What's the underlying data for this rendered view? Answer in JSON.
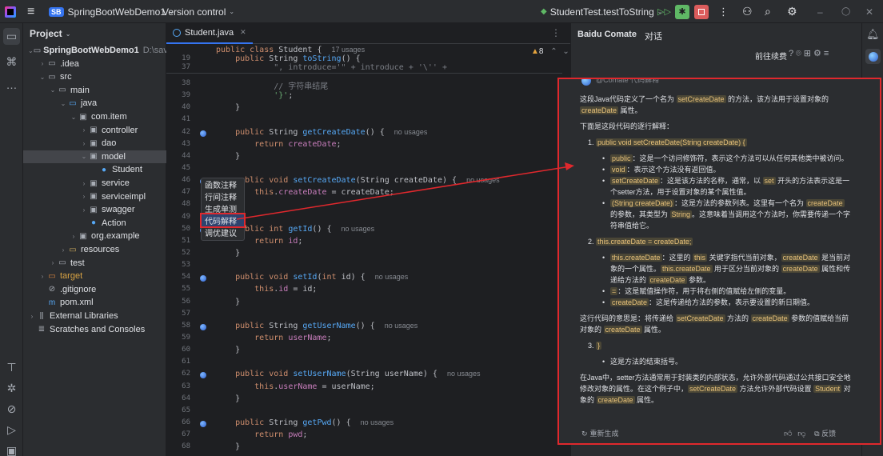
{
  "title_bar": {
    "project_badge": "SB",
    "project_name": "SpringBootWebDemo1",
    "vcs": "Version control",
    "run_config": "StudentTest.testToString"
  },
  "project_panel": {
    "title": "Project",
    "tree": [
      {
        "label": "SpringBootWebDemo1",
        "suffix": "D:\\save\\",
        "depth": 0,
        "open": true,
        "icon": "folder-icon",
        "bold": true
      },
      {
        "label": ".idea",
        "depth": 1,
        "open": false,
        "icon": "folder-icon"
      },
      {
        "label": "src",
        "depth": 1,
        "open": true,
        "icon": "folder-icon"
      },
      {
        "label": "main",
        "depth": 2,
        "open": true,
        "icon": "folder-icon"
      },
      {
        "label": "java",
        "depth": 3,
        "open": true,
        "icon": "source-folder-icon"
      },
      {
        "label": "com.item",
        "depth": 4,
        "open": true,
        "icon": "package-icon"
      },
      {
        "label": "controller",
        "depth": 5,
        "open": false,
        "icon": "package-icon"
      },
      {
        "label": "dao",
        "depth": 5,
        "open": false,
        "icon": "package-icon"
      },
      {
        "label": "model",
        "depth": 5,
        "open": true,
        "icon": "package-icon",
        "selected": true
      },
      {
        "label": "Student",
        "depth": 6,
        "icon": "class-icon"
      },
      {
        "label": "service",
        "depth": 5,
        "open": false,
        "icon": "package-icon"
      },
      {
        "label": "serviceimpl",
        "depth": 5,
        "open": false,
        "icon": "package-icon"
      },
      {
        "label": "swagger",
        "depth": 5,
        "open": false,
        "icon": "package-icon"
      },
      {
        "label": "Action",
        "depth": 5,
        "icon": "class-icon"
      },
      {
        "label": "org.example",
        "depth": 4,
        "open": false,
        "icon": "package-icon"
      },
      {
        "label": "resources",
        "depth": 3,
        "open": false,
        "icon": "resources-folder-icon"
      },
      {
        "label": "test",
        "depth": 2,
        "open": false,
        "icon": "folder-icon"
      },
      {
        "label": "target",
        "depth": 1,
        "open": false,
        "icon": "excluded-folder-icon"
      },
      {
        "label": ".gitignore",
        "depth": 1,
        "icon": "gitignore-icon"
      },
      {
        "label": "pom.xml",
        "depth": 1,
        "icon": "maven-icon"
      },
      {
        "label": "External Libraries",
        "depth": 0,
        "open": false,
        "icon": "library-icon"
      },
      {
        "label": "Scratches and Consoles",
        "depth": 0,
        "icon": "scratches-icon"
      }
    ]
  },
  "editor": {
    "tab": "Student.java",
    "warnings": "8",
    "sticky_lines": [
      {
        "num": "",
        "segs": [
          {
            "t": "public class ",
            "c": "kw"
          },
          {
            "t": "Student",
            "c": ""
          },
          {
            "t": " {  ",
            "c": ""
          },
          {
            "t": "17 usages",
            "c": "usage"
          }
        ]
      },
      {
        "num": "19",
        "segs": [
          {
            "t": "    public ",
            "c": "kw"
          },
          {
            "t": "String ",
            "c": ""
          },
          {
            "t": "toString",
            "c": "fn"
          },
          {
            "t": "() {",
            "c": ""
          }
        ]
      },
      {
        "num": "37",
        "segs": [
          {
            "t": "            \", introduce='\" + introduce + '\\'' +",
            "c": "cm"
          }
        ]
      }
    ],
    "lines": [
      {
        "num": "38",
        "segs": [
          {
            "t": "            // 字符串结尾",
            "c": "cm"
          }
        ]
      },
      {
        "num": "39",
        "segs": [
          {
            "t": "            ",
            "c": ""
          },
          {
            "t": "'}'",
            "c": "str"
          },
          {
            "t": ";",
            "c": ""
          }
        ]
      },
      {
        "num": "40",
        "segs": [
          {
            "t": "    }",
            "c": ""
          }
        ]
      },
      {
        "num": "41",
        "segs": []
      },
      {
        "num": "42",
        "icon": true,
        "segs": [
          {
            "t": "    public ",
            "c": "kw"
          },
          {
            "t": "String ",
            "c": ""
          },
          {
            "t": "getCreateDate",
            "c": "fn"
          },
          {
            "t": "() {  ",
            "c": ""
          },
          {
            "t": "no usages",
            "c": "usage"
          }
        ]
      },
      {
        "num": "43",
        "segs": [
          {
            "t": "        return ",
            "c": "kw"
          },
          {
            "t": "createDate",
            "c": "fld"
          },
          {
            "t": ";",
            "c": ""
          }
        ]
      },
      {
        "num": "44",
        "segs": [
          {
            "t": "    }",
            "c": ""
          }
        ]
      },
      {
        "num": "45",
        "segs": []
      },
      {
        "num": "46",
        "icon": true,
        "segs": [
          {
            "t": "    public void ",
            "c": "kw"
          },
          {
            "t": "setCreateDate",
            "c": "fn"
          },
          {
            "t": "(String createDate) {  ",
            "c": ""
          },
          {
            "t": "no usages",
            "c": "usage"
          }
        ]
      },
      {
        "num": "47",
        "segs": [
          {
            "t": "        this",
            "c": "kw"
          },
          {
            "t": ".",
            "c": ""
          },
          {
            "t": "createDate",
            "c": "fld"
          },
          {
            "t": " = createDate;",
            "c": ""
          }
        ]
      },
      {
        "num": "48",
        "segs": [
          {
            "t": "    }",
            "c": ""
          }
        ]
      },
      {
        "num": "49",
        "segs": []
      },
      {
        "num": "50",
        "icon": true,
        "segs": [
          {
            "t": "    public int ",
            "c": "kw"
          },
          {
            "t": "getId",
            "c": "fn"
          },
          {
            "t": "() {  ",
            "c": ""
          },
          {
            "t": "no usages",
            "c": "usage"
          }
        ]
      },
      {
        "num": "51",
        "segs": [
          {
            "t": "        return ",
            "c": "kw"
          },
          {
            "t": "id",
            "c": "fld"
          },
          {
            "t": ";",
            "c": ""
          }
        ]
      },
      {
        "num": "52",
        "segs": [
          {
            "t": "    }",
            "c": ""
          }
        ]
      },
      {
        "num": "53",
        "segs": []
      },
      {
        "num": "54",
        "icon": true,
        "segs": [
          {
            "t": "    public void ",
            "c": "kw"
          },
          {
            "t": "setId",
            "c": "fn"
          },
          {
            "t": "(",
            "c": ""
          },
          {
            "t": "int ",
            "c": "kw"
          },
          {
            "t": "id) {  ",
            "c": ""
          },
          {
            "t": "no usages",
            "c": "usage"
          }
        ]
      },
      {
        "num": "55",
        "segs": [
          {
            "t": "        this",
            "c": "kw"
          },
          {
            "t": ".",
            "c": ""
          },
          {
            "t": "id",
            "c": "fld"
          },
          {
            "t": " = id;",
            "c": ""
          }
        ]
      },
      {
        "num": "56",
        "segs": [
          {
            "t": "    }",
            "c": ""
          }
        ]
      },
      {
        "num": "57",
        "segs": []
      },
      {
        "num": "58",
        "icon": true,
        "segs": [
          {
            "t": "    public ",
            "c": "kw"
          },
          {
            "t": "String ",
            "c": ""
          },
          {
            "t": "getUserName",
            "c": "fn"
          },
          {
            "t": "() {  ",
            "c": ""
          },
          {
            "t": "no usages",
            "c": "usage"
          }
        ]
      },
      {
        "num": "59",
        "segs": [
          {
            "t": "        return ",
            "c": "kw"
          },
          {
            "t": "userName",
            "c": "fld"
          },
          {
            "t": ";",
            "c": ""
          }
        ]
      },
      {
        "num": "60",
        "segs": [
          {
            "t": "    }",
            "c": ""
          }
        ]
      },
      {
        "num": "61",
        "segs": []
      },
      {
        "num": "62",
        "icon": true,
        "segs": [
          {
            "t": "    public void ",
            "c": "kw"
          },
          {
            "t": "setUserName",
            "c": "fn"
          },
          {
            "t": "(String userName) {  ",
            "c": ""
          },
          {
            "t": "no usages",
            "c": "usage"
          }
        ]
      },
      {
        "num": "63",
        "segs": [
          {
            "t": "        this",
            "c": "kw"
          },
          {
            "t": ".",
            "c": ""
          },
          {
            "t": "userName",
            "c": "fld"
          },
          {
            "t": " = userName;",
            "c": ""
          }
        ]
      },
      {
        "num": "64",
        "segs": [
          {
            "t": "    }",
            "c": ""
          }
        ]
      },
      {
        "num": "65",
        "segs": []
      },
      {
        "num": "66",
        "icon": true,
        "segs": [
          {
            "t": "    public ",
            "c": "kw"
          },
          {
            "t": "String ",
            "c": ""
          },
          {
            "t": "getPwd",
            "c": "fn"
          },
          {
            "t": "() {  ",
            "c": ""
          },
          {
            "t": "no usages",
            "c": "usage"
          }
        ]
      },
      {
        "num": "67",
        "segs": [
          {
            "t": "        return ",
            "c": "kw"
          },
          {
            "t": "pwd",
            "c": "fld"
          },
          {
            "t": ";",
            "c": ""
          }
        ]
      },
      {
        "num": "68",
        "segs": [
          {
            "t": "    }",
            "c": ""
          }
        ]
      }
    ],
    "context_menu": [
      "函数注释",
      "行间注释",
      "生成单测",
      "代码解释",
      "调优建议"
    ],
    "context_menu_selected": 3
  },
  "comate": {
    "title": "Baidu Comate",
    "tab": "对话",
    "continue_label": "前往续费",
    "author": "@Comate",
    "author_action": "代码解释",
    "answer": {
      "p1": [
        {
          "t": "这段Java代码定义了一个名为 "
        },
        {
          "t": "setCreateDate",
          "h": 1
        },
        {
          "t": " 的方法，该方法用于设置对象的 "
        },
        {
          "t": "createDate",
          "h": 1
        },
        {
          "t": " 属性。"
        }
      ],
      "p2": [
        {
          "t": "下面是这段代码的逐行解释："
        }
      ],
      "s1_head": [
        {
          "t": "public void setCreateDate(String createDate) {",
          "h": 1
        }
      ],
      "s1_items": [
        [
          {
            "t": "public",
            "h": 1
          },
          {
            "t": "：这是一个访问修饰符，表示这个方法可以从任何其他类中被访问。"
          }
        ],
        [
          {
            "t": "void",
            "h": 1
          },
          {
            "t": "：表示这个方法没有返回值。"
          }
        ],
        [
          {
            "t": "setCreateDate",
            "h": 1
          },
          {
            "t": "：这是该方法的名称，通常，以 "
          },
          {
            "t": "set",
            "h": 1
          },
          {
            "t": " 开头的方法表示这是一个setter方法，用于设置对象的某个属性值。"
          }
        ],
        [
          {
            "t": "(String createDate)",
            "h": 1
          },
          {
            "t": "：这是方法的参数列表。这里有一个名为 "
          },
          {
            "t": "createDate",
            "h": 1
          },
          {
            "t": " 的参数，其类型为 "
          },
          {
            "t": "String",
            "h": 1
          },
          {
            "t": "。这意味着当调用这个方法时，你需要传递一个字符串值给它。"
          }
        ]
      ],
      "s2_head": [
        {
          "t": "this.createDate = createDate;",
          "h": 1
        }
      ],
      "s2_items": [
        [
          {
            "t": "this.createDate",
            "h": 1
          },
          {
            "t": "：这里的 "
          },
          {
            "t": "this",
            "h": 1
          },
          {
            "t": " 关键字指代当前对象，"
          },
          {
            "t": "createDate",
            "h": 1
          },
          {
            "t": " 是当前对象的一个属性。"
          },
          {
            "t": "this.createDate",
            "h": 1
          },
          {
            "t": " 用于区分当前对象的 "
          },
          {
            "t": "createDate",
            "h": 1
          },
          {
            "t": " 属性和传递给方法的 "
          },
          {
            "t": "createDate",
            "h": 1
          },
          {
            "t": " 参数。"
          }
        ],
        [
          {
            "t": "=",
            "h": 1
          },
          {
            "t": "：这是赋值操作符，用于将右侧的值赋给左侧的变量。"
          }
        ],
        [
          {
            "t": "createDate",
            "h": 1
          },
          {
            "t": "：这是传递给方法的参数，表示要设置的新日期值。"
          }
        ]
      ],
      "p3": [
        {
          "t": "这行代码的意思是：将传递给 "
        },
        {
          "t": "setCreateDate",
          "h": 1
        },
        {
          "t": " 方法的 "
        },
        {
          "t": "createDate",
          "h": 1
        },
        {
          "t": " 参数的值赋给当前对象的 "
        },
        {
          "t": "createDate",
          "h": 1
        },
        {
          "t": " 属性。"
        }
      ],
      "s3_head": [
        {
          "t": "}",
          "h": 1
        }
      ],
      "s3_items": [
        [
          {
            "t": "这是方法的结束括号。"
          }
        ]
      ],
      "p4": [
        {
          "t": "在Java中，setter方法通常用于封装类的内部状态，允许外部代码通过公共接口安全地修改对象的属性。在这个例子中，"
        },
        {
          "t": "setCreateDate",
          "h": 1
        },
        {
          "t": " 方法允许外部代码设置 "
        },
        {
          "t": "Student",
          "h": 1
        },
        {
          "t": " 对象的 "
        },
        {
          "t": "createDate",
          "h": 1
        },
        {
          "t": " 属性。"
        }
      ]
    },
    "regenerate_label": "重新生成",
    "feedback_label": "反馈"
  },
  "colors": {
    "accent": "#3574f0",
    "highlight_border": "#e0282d",
    "highlight_bg": "#4a4636",
    "highlight_fg": "#e8c27a"
  }
}
